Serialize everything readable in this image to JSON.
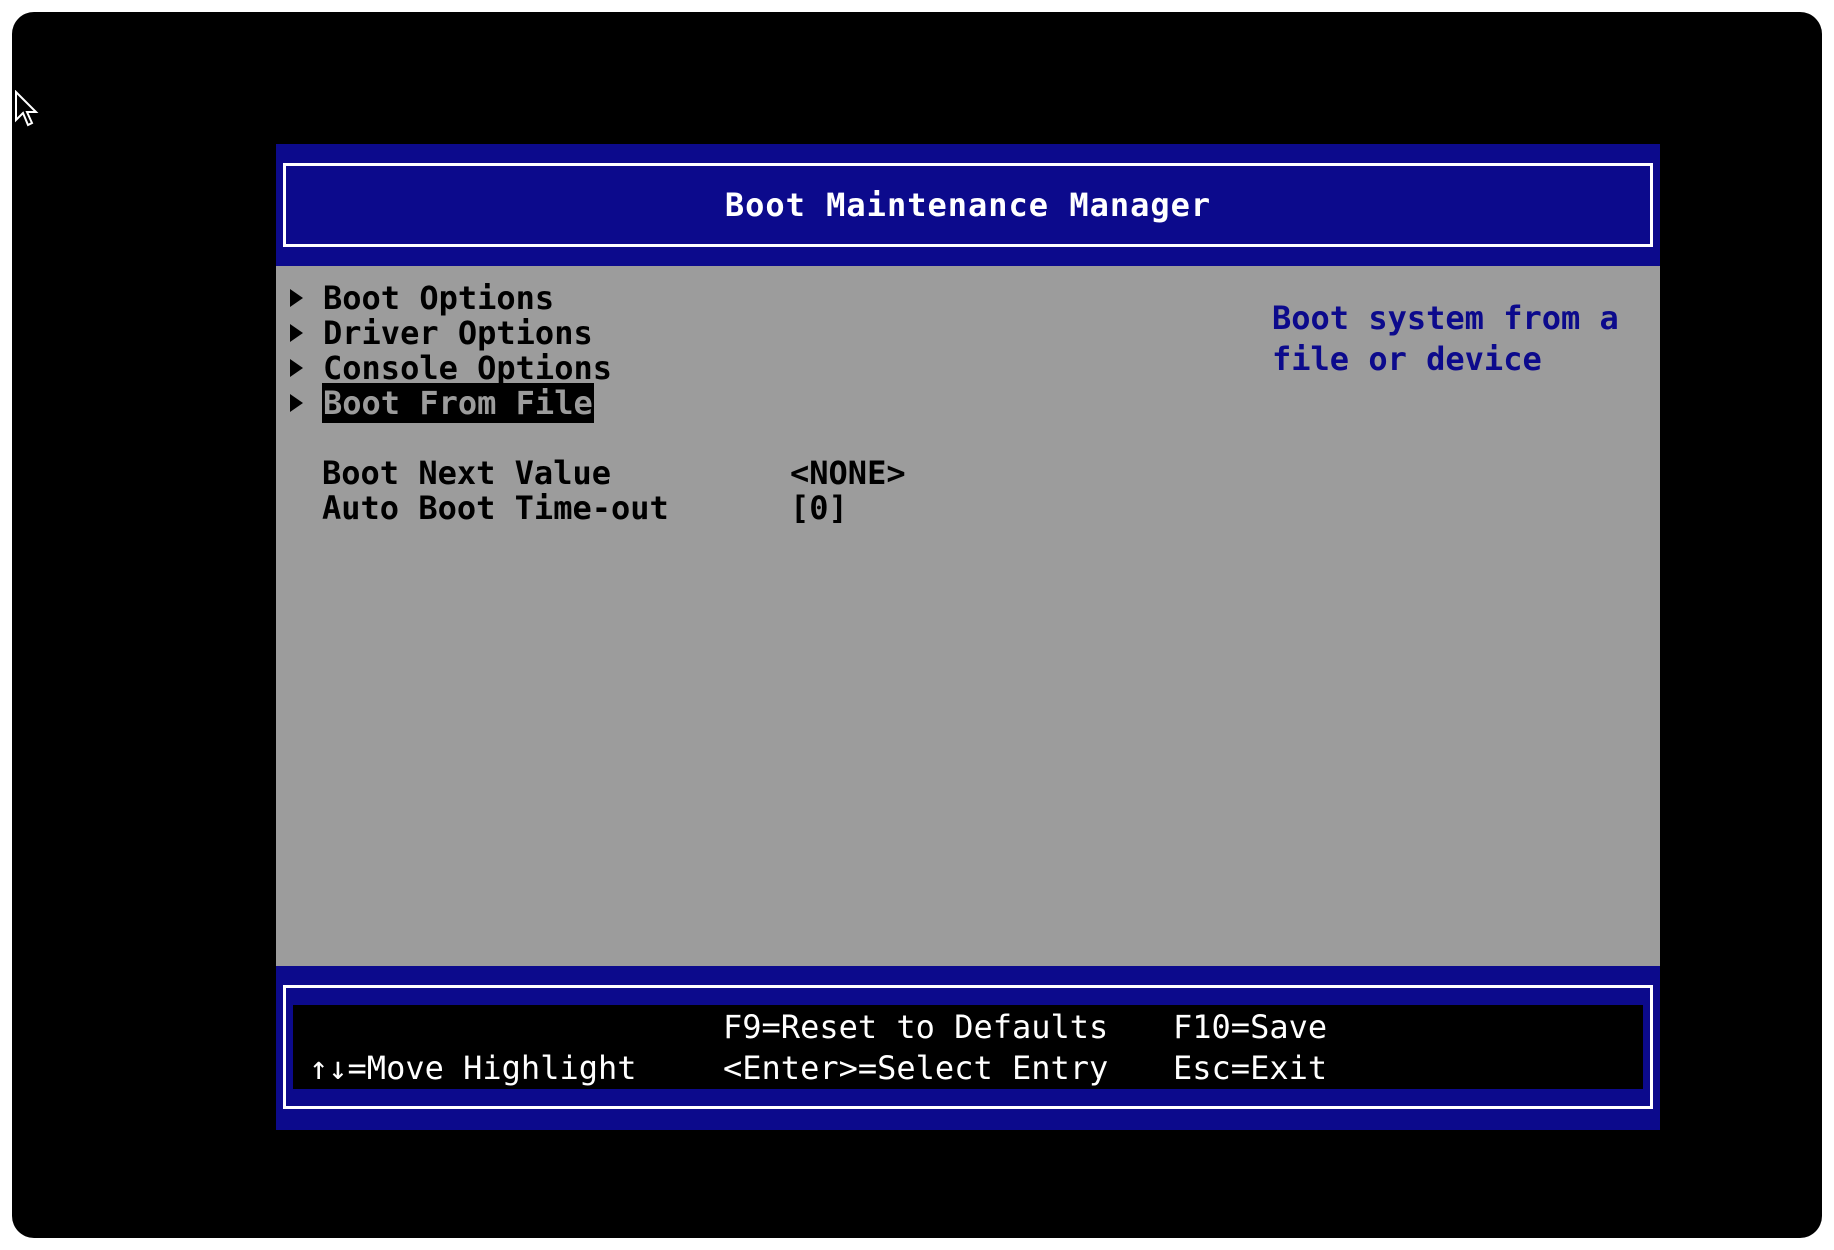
{
  "title": "Boot Maintenance Manager",
  "menu": [
    {
      "label": "Boot Options"
    },
    {
      "label": "Driver Options"
    },
    {
      "label": "Console Options"
    },
    {
      "label": "Boot From File"
    }
  ],
  "selected_item": "Boot From File",
  "settings": [
    {
      "label": "Boot Next Value",
      "value": "<NONE>"
    },
    {
      "label": "Auto Boot Time-out",
      "value": "[0]"
    }
  ],
  "help": "Boot system from a\nfile or device",
  "footer": {
    "move": "↑↓=Move Highlight",
    "reset": "F9=Reset to Defaults",
    "select": "<Enter>=Select Entry",
    "save": "F10=Save",
    "exit": "Esc=Exit"
  },
  "colors": {
    "band": "#0c0a8c",
    "panel": "#9c9c9c",
    "help_text": "#0c0a8c",
    "screen_bg": "#000000"
  },
  "icons": {
    "cursor": "mouse-pointer-icon",
    "menu_arrow": "triangle-right-icon"
  }
}
